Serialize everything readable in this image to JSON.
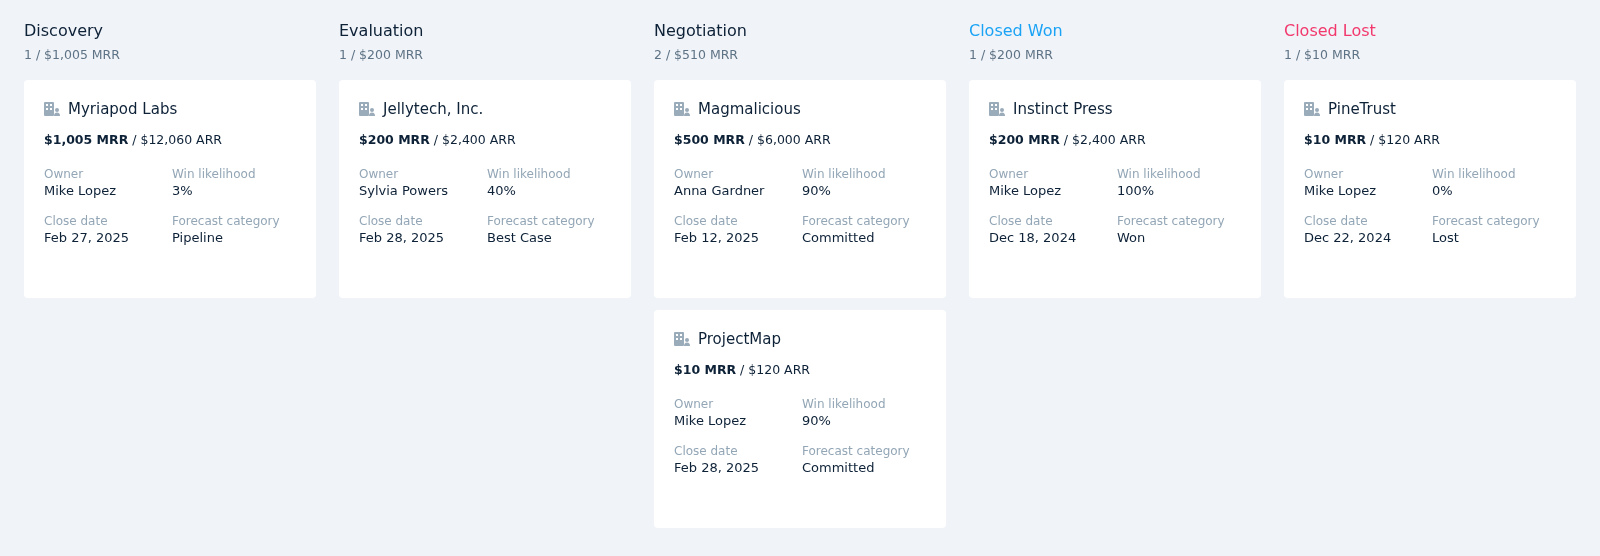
{
  "columns": [
    {
      "title": "Discovery",
      "color": "#0d2137",
      "summary": "1 / $1,005 MRR",
      "cards": [
        {
          "company": "Myriapod Labs",
          "amount": "**$1,005 MRR** / $12,060 ARR",
          "fields": [
            {
              "label": "Owner",
              "value": "Mike Lopez"
            },
            {
              "label": "Win likelihood",
              "value": "3%"
            },
            {
              "label": "Close date",
              "value": "Feb 27, 2025"
            },
            {
              "label": "Forecast category",
              "value": "Pipeline"
            }
          ]
        }
      ]
    },
    {
      "title": "Evaluation",
      "color": "#0d2137",
      "summary": "1 / $200 MRR",
      "cards": [
        {
          "company": "Jellytech, Inc.",
          "amount": "**$200 MRR** / $2,400 ARR",
          "fields": [
            {
              "label": "Owner",
              "value": "Sylvia Powers"
            },
            {
              "label": "Win likelihood",
              "value": "40%"
            },
            {
              "label": "Close date",
              "value": "Feb 28, 2025"
            },
            {
              "label": "Forecast category",
              "value": "Best Case"
            }
          ]
        }
      ]
    },
    {
      "title": "Negotiation",
      "color": "#0d2137",
      "summary": "2 / $510 MRR",
      "cards": [
        {
          "company": "Magmalicious",
          "amount": "**$500 MRR** / $6,000 ARR",
          "fields": [
            {
              "label": "Owner",
              "value": "Anna Gardner"
            },
            {
              "label": "Win likelihood",
              "value": "90%"
            },
            {
              "label": "Close date",
              "value": "Feb 12, 2025"
            },
            {
              "label": "Forecast category",
              "value": "Committed"
            }
          ]
        },
        {
          "company": "ProjectMap",
          "amount": "**$10 MRR** / $120 ARR",
          "fields": [
            {
              "label": "Owner",
              "value": "Mike Lopez"
            },
            {
              "label": "Win likelihood",
              "value": "90%"
            },
            {
              "label": "Close date",
              "value": "Feb 28, 2025"
            },
            {
              "label": "Forecast category",
              "value": "Committed"
            }
          ]
        }
      ]
    },
    {
      "title": "Closed Won",
      "color": "#1aa3f5",
      "summary": "1 / $200 MRR",
      "cards": [
        {
          "company": "Instinct Press",
          "amount": "**$200 MRR** / $2,400 ARR",
          "fields": [
            {
              "label": "Owner",
              "value": "Mike Lopez"
            },
            {
              "label": "Win likelihood",
              "value": "100%"
            },
            {
              "label": "Close date",
              "value": "Dec 18, 2024"
            },
            {
              "label": "Forecast category",
              "value": "Won"
            }
          ]
        }
      ]
    },
    {
      "title": "Closed Lost",
      "color": "#f2386c",
      "summary": "1 / $10 MRR",
      "cards": [
        {
          "company": "PineTrust",
          "amount": "**$10 MRR** / $120 ARR",
          "fields": [
            {
              "label": "Owner",
              "value": "Mike Lopez"
            },
            {
              "label": "Win likelihood",
              "value": "0%"
            },
            {
              "label": "Close date",
              "value": "Dec 22, 2024"
            },
            {
              "label": "Forecast category",
              "value": "Lost"
            }
          ]
        }
      ]
    }
  ]
}
